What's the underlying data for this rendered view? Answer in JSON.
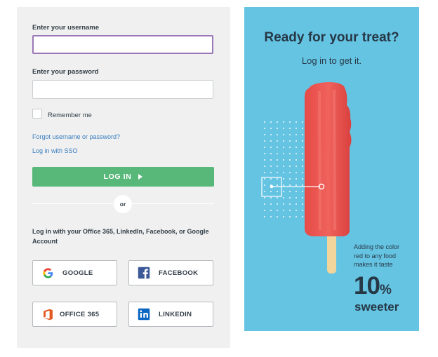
{
  "login": {
    "username_label": "Enter your username",
    "username_value": "",
    "password_label": "Enter your password",
    "password_value": "",
    "remember_label": "Remember me",
    "forgot_link": "Forgot username or password?",
    "sso_link": "Log in with SSO",
    "login_button": "LOG IN",
    "or_label": "or",
    "social_text": "Log in with your Office 365, LinkedIn, Facebook, or Google Account",
    "social": {
      "google": "GOOGLE",
      "facebook": "FACEBOOK",
      "office": "OFFICE 365",
      "linkedin": "LINKEDIN"
    }
  },
  "promo": {
    "title": "Ready for your treat?",
    "subtitle": "Log in to get it.",
    "fact": "Adding the color red to any food makes it taste",
    "big_number": "10",
    "big_percent": "%",
    "big_word": "sweeter"
  },
  "colors": {
    "panel_bg": "#eff0ef",
    "login_button": "#58b87a",
    "link": "#3b7ec0",
    "focus_border": "#9b78b8",
    "promo_bg": "#66c4e3",
    "popsicle": "#e5524f"
  },
  "icons": {
    "google": "google-logo-icon",
    "facebook": "facebook-logo-icon",
    "office": "office-365-logo-icon",
    "linkedin": "linkedin-logo-icon",
    "arrow": "play-arrow-icon"
  }
}
